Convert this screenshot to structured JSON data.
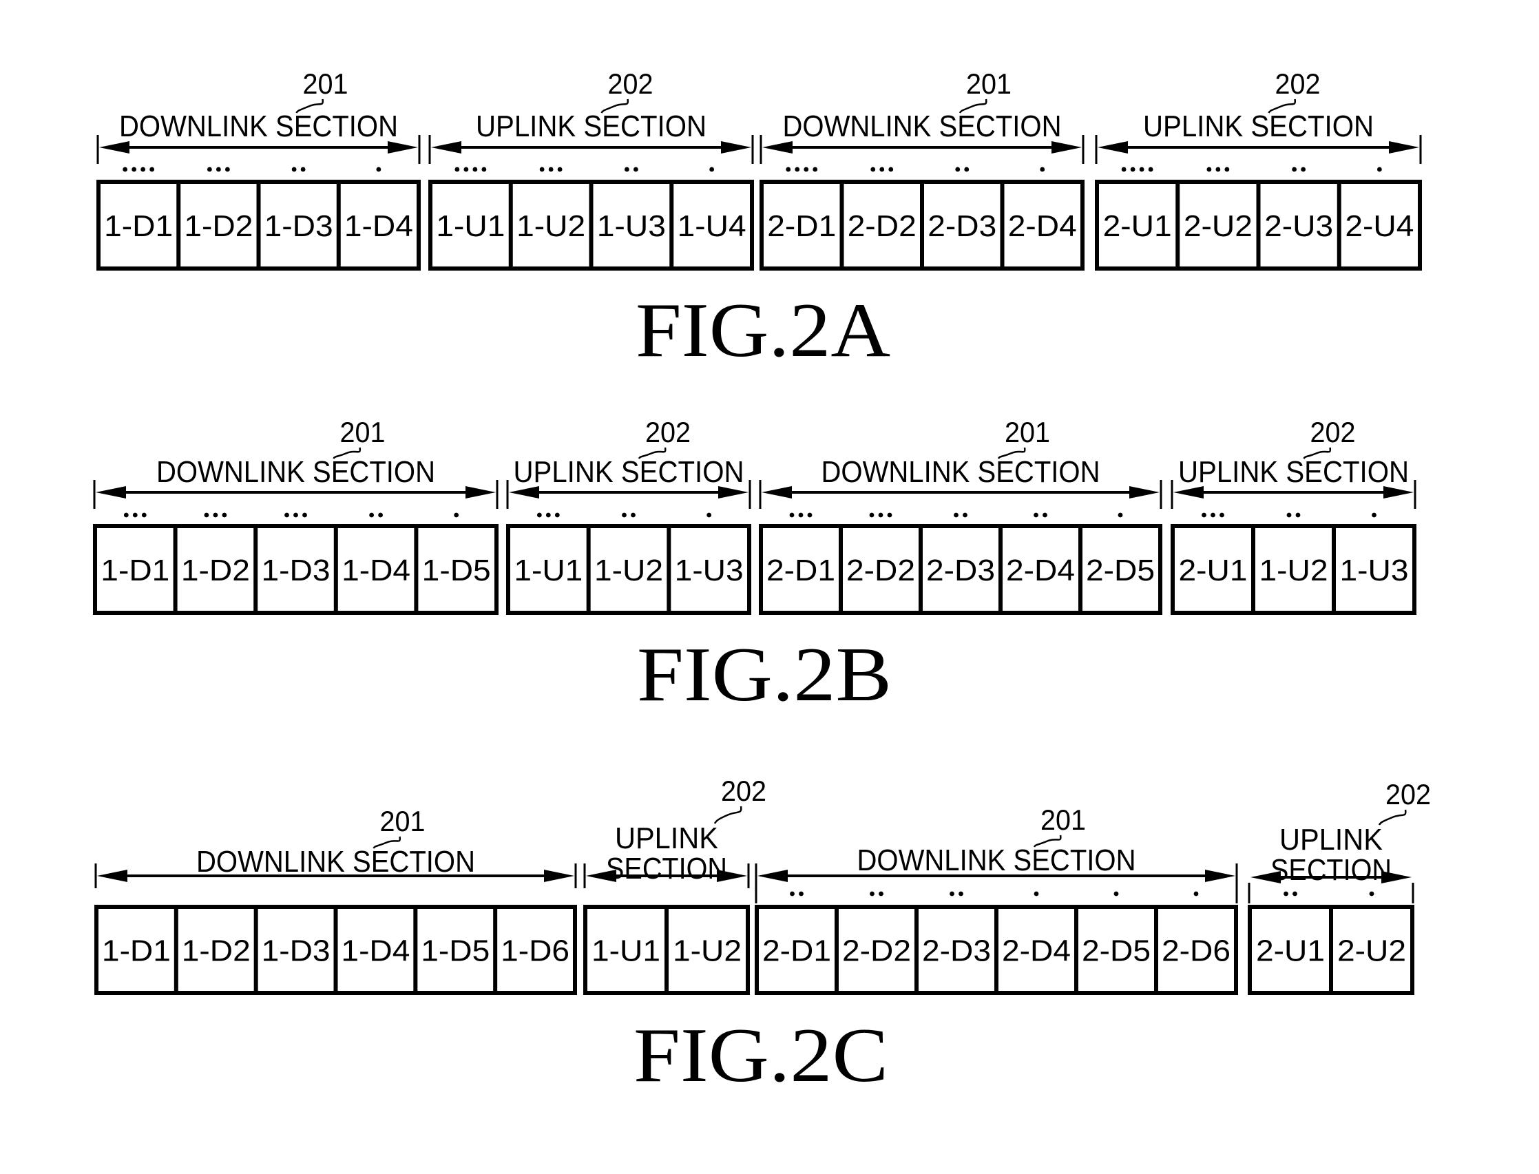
{
  "colors": {
    "ink": "#000000",
    "background": "#ffffff"
  },
  "figures": [
    {
      "caption": "FIG.2A",
      "blocks": [
        {
          "type": "downlink",
          "ref": "201",
          "label_lines": [
            "DOWNLINK SECTION"
          ],
          "cells": [
            "1-D1",
            "1-D2",
            "1-D3",
            "1-D4"
          ],
          "dots": [
            4,
            3,
            2,
            1
          ]
        },
        {
          "type": "uplink",
          "ref": "202",
          "label_lines": [
            "UPLINK SECTION"
          ],
          "cells": [
            "1-U1",
            "1-U2",
            "1-U3",
            "1-U4"
          ],
          "dots": [
            4,
            3,
            2,
            1
          ]
        },
        {
          "type": "downlink",
          "ref": "201",
          "label_lines": [
            "DOWNLINK SECTION"
          ],
          "cells": [
            "2-D1",
            "2-D2",
            "2-D3",
            "2-D4"
          ],
          "dots": [
            4,
            3,
            2,
            1
          ]
        },
        {
          "type": "uplink",
          "ref": "202",
          "label_lines": [
            "UPLINK SECTION"
          ],
          "cells": [
            "2-U1",
            "2-U2",
            "2-U3",
            "2-U4"
          ],
          "dots": [
            4,
            3,
            2,
            1
          ]
        }
      ]
    },
    {
      "caption": "FIG.2B",
      "blocks": [
        {
          "type": "downlink",
          "ref": "201",
          "label_lines": [
            "DOWNLINK SECTION"
          ],
          "cells": [
            "1-D1",
            "1-D2",
            "1-D3",
            "1-D4",
            "1-D5"
          ],
          "dots": [
            3,
            3,
            3,
            2,
            1
          ]
        },
        {
          "type": "uplink",
          "ref": "202",
          "label_lines": [
            "UPLINK SECTION"
          ],
          "cells": [
            "1-U1",
            "1-U2",
            "1-U3"
          ],
          "dots": [
            3,
            2,
            1
          ]
        },
        {
          "type": "downlink",
          "ref": "201",
          "label_lines": [
            "DOWNLINK SECTION"
          ],
          "cells": [
            "2-D1",
            "2-D2",
            "2-D3",
            "2-D4",
            "2-D5"
          ],
          "dots": [
            3,
            3,
            2,
            2,
            1
          ]
        },
        {
          "type": "uplink",
          "ref": "202",
          "label_lines": [
            "UPLINK SECTION"
          ],
          "cells": [
            "2-U1",
            "1-U2",
            "1-U3"
          ],
          "dots": [
            3,
            2,
            1
          ]
        }
      ]
    },
    {
      "caption": "FIG.2C",
      "blocks": [
        {
          "type": "downlink",
          "ref": "201",
          "label_lines": [
            "DOWNLINK SECTION"
          ],
          "cells": [
            "1-D1",
            "1-D2",
            "1-D3",
            "1-D4",
            "1-D5",
            "1-D6"
          ],
          "dots": [
            0,
            0,
            0,
            0,
            0,
            0
          ]
        },
        {
          "type": "uplink",
          "ref": "202",
          "label_lines": [
            "UPLINK",
            "SECTION"
          ],
          "cells": [
            "1-U1",
            "1-U2"
          ],
          "dots": [
            0,
            0
          ]
        },
        {
          "type": "downlink",
          "ref": "201",
          "label_lines": [
            "DOWNLINK SECTION"
          ],
          "cells": [
            "2-D1",
            "2-D2",
            "2-D3",
            "2-D4",
            "2-D5",
            "2-D6"
          ],
          "dots": [
            2,
            2,
            2,
            1,
            1,
            1
          ]
        },
        {
          "type": "uplink",
          "ref": "202",
          "label_lines": [
            "UPLINK",
            "SECTION"
          ],
          "cells": [
            "2-U1",
            "2-U2"
          ],
          "dots": [
            2,
            1
          ]
        }
      ]
    }
  ]
}
